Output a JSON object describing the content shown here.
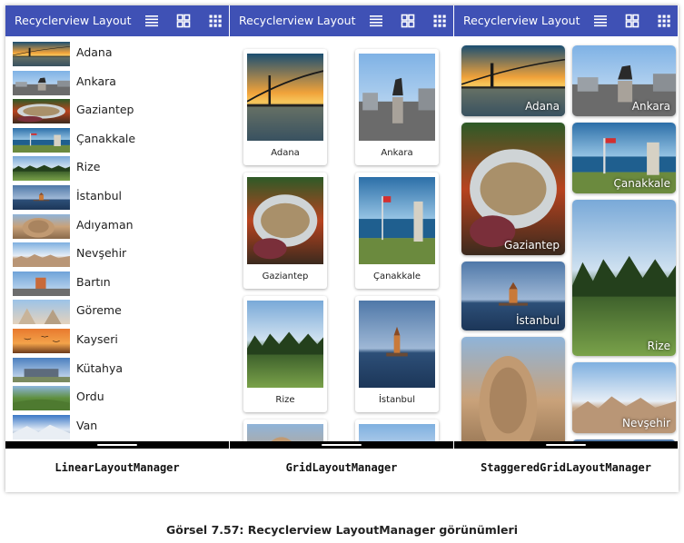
{
  "screens": [
    {
      "appbar_title": "Recyclerview Layout",
      "icons": [
        "list-view-icon",
        "grid-view-icon",
        "staggered-grid-icon"
      ],
      "layout_manager": "LinearLayoutManager",
      "items": [
        "Adana",
        "Ankara",
        "Gaziantep",
        "Çanakkale",
        "Rize",
        "İstanbul",
        "Adıyaman",
        "Nevşehir",
        "Bartın",
        "Göreme",
        "Kayseri",
        "Kütahya",
        "Ordu",
        "Van"
      ]
    },
    {
      "appbar_title": "Recyclerview Layout",
      "icons": [
        "list-view-icon",
        "grid-view-icon",
        "staggered-grid-icon"
      ],
      "layout_manager": "GridLayoutManager",
      "items": [
        "Adana",
        "Ankara",
        "Gaziantep",
        "Çanakkale",
        "Rize",
        "İstanbul"
      ]
    },
    {
      "appbar_title": "Recyclerview Layout",
      "icons": [
        "list-view-icon",
        "grid-view-icon",
        "staggered-grid-icon"
      ],
      "layout_manager": "StaggeredGridLayoutManager",
      "items": [
        "Adana",
        "Ankara",
        "Çanakkale",
        "Gaziantep",
        "Rize",
        "İstanbul",
        "Nevşehir"
      ]
    }
  ],
  "colors": {
    "appbar": "#3f51b5",
    "navbar": "#000000"
  },
  "caption": "Görsel 7.57: Recyclerview LayoutManager görünümleri"
}
